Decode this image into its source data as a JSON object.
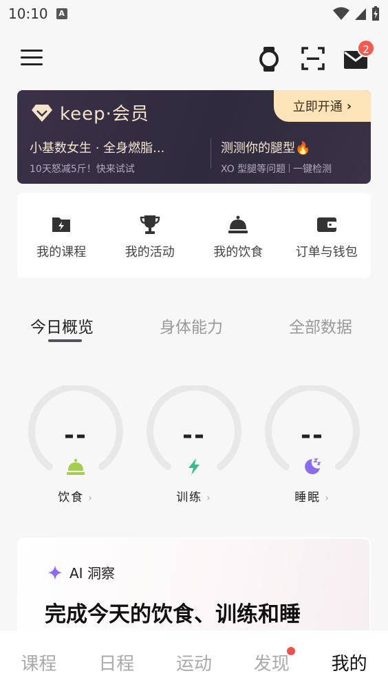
{
  "status": {
    "time": "10:10",
    "app_badge": "A"
  },
  "header": {
    "mail_badge": "2"
  },
  "vip": {
    "logo": "keep·会员",
    "cta": "立即开通",
    "left_title": "小基数女生 · 全身燃脂...",
    "left_sub": "10天怒减5斤！快来试试",
    "right_title": "测测你的腿型🔥",
    "right_sub_1": "XO 型腿等问题",
    "right_sub_2": "一键检测"
  },
  "quick_actions": [
    {
      "label": "我的课程",
      "icon": "course-folder-icon"
    },
    {
      "label": "我的活动",
      "icon": "trophy-icon"
    },
    {
      "label": "我的饮食",
      "icon": "cloche-icon"
    },
    {
      "label": "订单与钱包",
      "icon": "wallet-icon"
    }
  ],
  "tabs": [
    {
      "label": "今日概览",
      "active": true
    },
    {
      "label": "身体能力",
      "active": false
    },
    {
      "label": "全部数据",
      "active": false
    }
  ],
  "rings": [
    {
      "value": "--",
      "label": "饮食",
      "icon": "cloche-icon",
      "color": "#a3cf4d"
    },
    {
      "value": "--",
      "label": "训练",
      "icon": "lightning-icon",
      "color": "#2ec28a"
    },
    {
      "value": "--",
      "label": "睡眠",
      "icon": "moon-icon",
      "color": "#8a6cf0"
    }
  ],
  "ai": {
    "head": "AI 洞察",
    "title": "完成今天的饮食、训练和睡"
  },
  "bottom_nav": [
    {
      "label": "课程",
      "active": false
    },
    {
      "label": "日程",
      "active": false
    },
    {
      "label": "运动",
      "active": false
    },
    {
      "label": "发现",
      "active": false
    },
    {
      "label": "我的",
      "active": true
    }
  ]
}
